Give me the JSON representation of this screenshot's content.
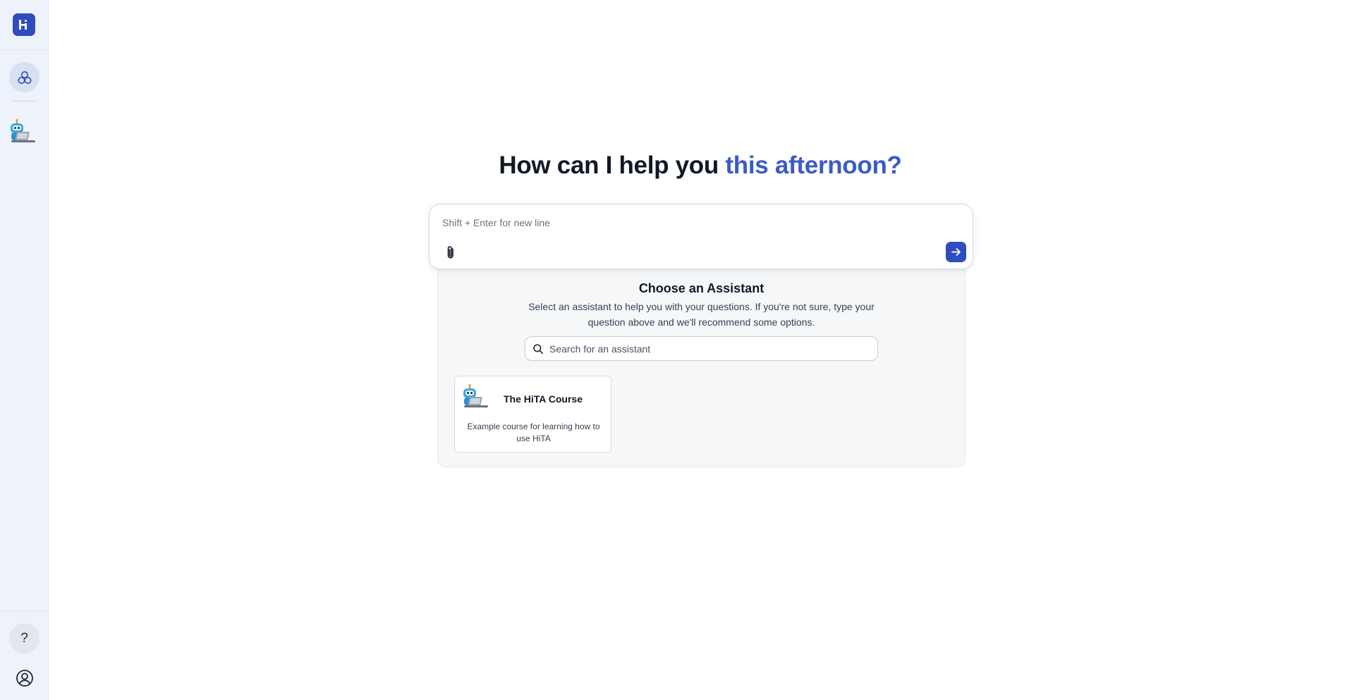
{
  "app": {
    "logo_letter": "H",
    "brand_color": "#2f4dbf",
    "accent_color": "#3b5bc7"
  },
  "sidebar": {
    "items": [
      {
        "name": "assistants",
        "icon": "circles-icon",
        "active": true
      },
      {
        "name": "hita-course-assistant",
        "icon": "robot-avatar-icon"
      }
    ],
    "bottom": [
      {
        "name": "help",
        "icon": "question-icon",
        "label": "?"
      },
      {
        "name": "profile",
        "icon": "user-circle-icon"
      }
    ]
  },
  "greeting": {
    "prefix": "How can I help you ",
    "accent": "this afternoon?"
  },
  "composer": {
    "placeholder": "Shift + Enter for new line",
    "value": ""
  },
  "assistant_picker": {
    "title": "Choose an Assistant",
    "description": "Select an assistant to help you with your questions. If you're not sure, type your question above and we'll recommend some options.",
    "search_placeholder": "Search for an assistant",
    "cards": [
      {
        "title": "The HiTA Course",
        "description": "Example course for learning how to use HiTA"
      }
    ]
  }
}
